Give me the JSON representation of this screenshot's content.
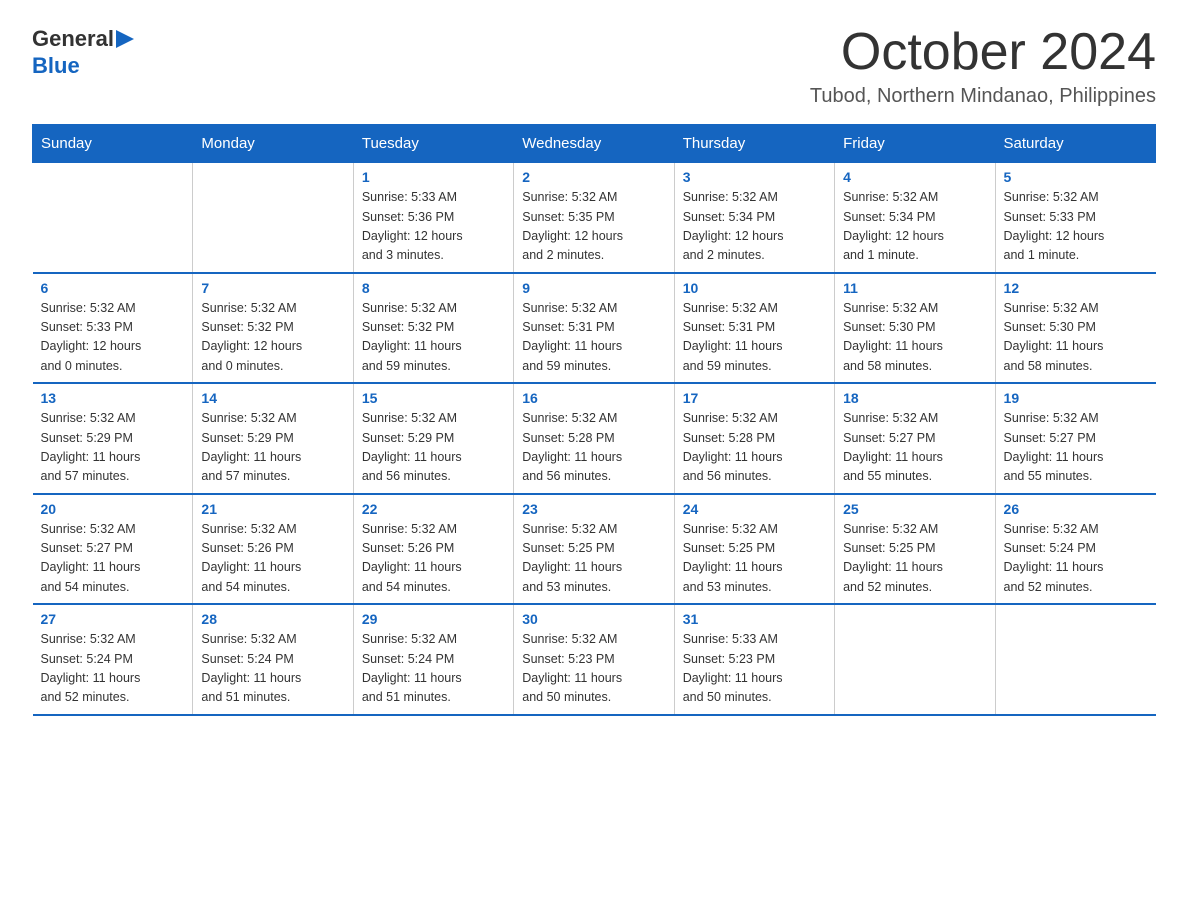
{
  "logo": {
    "general": "General",
    "blue": "Blue",
    "triangle": "▶"
  },
  "header": {
    "title": "October 2024",
    "subtitle": "Tubod, Northern Mindanao, Philippines"
  },
  "calendar": {
    "days_of_week": [
      "Sunday",
      "Monday",
      "Tuesday",
      "Wednesday",
      "Thursday",
      "Friday",
      "Saturday"
    ],
    "weeks": [
      [
        {
          "day": "",
          "info": ""
        },
        {
          "day": "",
          "info": ""
        },
        {
          "day": "1",
          "info": "Sunrise: 5:33 AM\nSunset: 5:36 PM\nDaylight: 12 hours\nand 3 minutes."
        },
        {
          "day": "2",
          "info": "Sunrise: 5:32 AM\nSunset: 5:35 PM\nDaylight: 12 hours\nand 2 minutes."
        },
        {
          "day": "3",
          "info": "Sunrise: 5:32 AM\nSunset: 5:34 PM\nDaylight: 12 hours\nand 2 minutes."
        },
        {
          "day": "4",
          "info": "Sunrise: 5:32 AM\nSunset: 5:34 PM\nDaylight: 12 hours\nand 1 minute."
        },
        {
          "day": "5",
          "info": "Sunrise: 5:32 AM\nSunset: 5:33 PM\nDaylight: 12 hours\nand 1 minute."
        }
      ],
      [
        {
          "day": "6",
          "info": "Sunrise: 5:32 AM\nSunset: 5:33 PM\nDaylight: 12 hours\nand 0 minutes."
        },
        {
          "day": "7",
          "info": "Sunrise: 5:32 AM\nSunset: 5:32 PM\nDaylight: 12 hours\nand 0 minutes."
        },
        {
          "day": "8",
          "info": "Sunrise: 5:32 AM\nSunset: 5:32 PM\nDaylight: 11 hours\nand 59 minutes."
        },
        {
          "day": "9",
          "info": "Sunrise: 5:32 AM\nSunset: 5:31 PM\nDaylight: 11 hours\nand 59 minutes."
        },
        {
          "day": "10",
          "info": "Sunrise: 5:32 AM\nSunset: 5:31 PM\nDaylight: 11 hours\nand 59 minutes."
        },
        {
          "day": "11",
          "info": "Sunrise: 5:32 AM\nSunset: 5:30 PM\nDaylight: 11 hours\nand 58 minutes."
        },
        {
          "day": "12",
          "info": "Sunrise: 5:32 AM\nSunset: 5:30 PM\nDaylight: 11 hours\nand 58 minutes."
        }
      ],
      [
        {
          "day": "13",
          "info": "Sunrise: 5:32 AM\nSunset: 5:29 PM\nDaylight: 11 hours\nand 57 minutes."
        },
        {
          "day": "14",
          "info": "Sunrise: 5:32 AM\nSunset: 5:29 PM\nDaylight: 11 hours\nand 57 minutes."
        },
        {
          "day": "15",
          "info": "Sunrise: 5:32 AM\nSunset: 5:29 PM\nDaylight: 11 hours\nand 56 minutes."
        },
        {
          "day": "16",
          "info": "Sunrise: 5:32 AM\nSunset: 5:28 PM\nDaylight: 11 hours\nand 56 minutes."
        },
        {
          "day": "17",
          "info": "Sunrise: 5:32 AM\nSunset: 5:28 PM\nDaylight: 11 hours\nand 56 minutes."
        },
        {
          "day": "18",
          "info": "Sunrise: 5:32 AM\nSunset: 5:27 PM\nDaylight: 11 hours\nand 55 minutes."
        },
        {
          "day": "19",
          "info": "Sunrise: 5:32 AM\nSunset: 5:27 PM\nDaylight: 11 hours\nand 55 minutes."
        }
      ],
      [
        {
          "day": "20",
          "info": "Sunrise: 5:32 AM\nSunset: 5:27 PM\nDaylight: 11 hours\nand 54 minutes."
        },
        {
          "day": "21",
          "info": "Sunrise: 5:32 AM\nSunset: 5:26 PM\nDaylight: 11 hours\nand 54 minutes."
        },
        {
          "day": "22",
          "info": "Sunrise: 5:32 AM\nSunset: 5:26 PM\nDaylight: 11 hours\nand 54 minutes."
        },
        {
          "day": "23",
          "info": "Sunrise: 5:32 AM\nSunset: 5:25 PM\nDaylight: 11 hours\nand 53 minutes."
        },
        {
          "day": "24",
          "info": "Sunrise: 5:32 AM\nSunset: 5:25 PM\nDaylight: 11 hours\nand 53 minutes."
        },
        {
          "day": "25",
          "info": "Sunrise: 5:32 AM\nSunset: 5:25 PM\nDaylight: 11 hours\nand 52 minutes."
        },
        {
          "day": "26",
          "info": "Sunrise: 5:32 AM\nSunset: 5:24 PM\nDaylight: 11 hours\nand 52 minutes."
        }
      ],
      [
        {
          "day": "27",
          "info": "Sunrise: 5:32 AM\nSunset: 5:24 PM\nDaylight: 11 hours\nand 52 minutes."
        },
        {
          "day": "28",
          "info": "Sunrise: 5:32 AM\nSunset: 5:24 PM\nDaylight: 11 hours\nand 51 minutes."
        },
        {
          "day": "29",
          "info": "Sunrise: 5:32 AM\nSunset: 5:24 PM\nDaylight: 11 hours\nand 51 minutes."
        },
        {
          "day": "30",
          "info": "Sunrise: 5:32 AM\nSunset: 5:23 PM\nDaylight: 11 hours\nand 50 minutes."
        },
        {
          "day": "31",
          "info": "Sunrise: 5:33 AM\nSunset: 5:23 PM\nDaylight: 11 hours\nand 50 minutes."
        },
        {
          "day": "",
          "info": ""
        },
        {
          "day": "",
          "info": ""
        }
      ]
    ]
  }
}
